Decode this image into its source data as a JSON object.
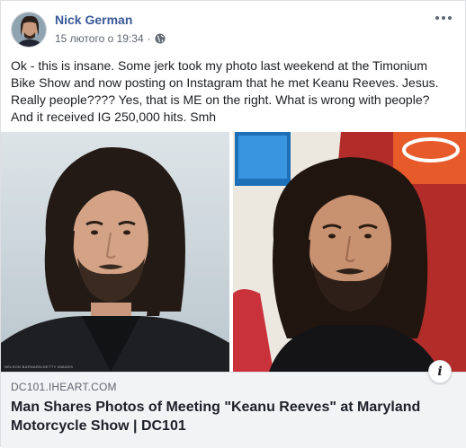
{
  "post": {
    "author": "Nick German",
    "timestamp": "15 лютого о 19:34",
    "separator": "·",
    "privacy_icon": "globe-icon",
    "more_icon": "more-horizontal-icon",
    "text": "Ok - this is insane. Some jerk took my photo last weekend at the Timonium Bike Show and now posting on Instagram that he met Keanu Reeves. Jesus. Really people???? Yes, that is ME on the right. What is wrong with people? And it received IG 250,000 hits. Smh"
  },
  "photos": {
    "left_credit": "NELSON BARNARD/GETTY IMAGES"
  },
  "link_preview": {
    "domain": "DC101.IHEART.COM",
    "title": "Man Shares Photos of Meeting \"Keanu Reeves\" at Maryland Motorcycle Show | DC101",
    "info_label": "i",
    "info_icon": "info-icon"
  },
  "colors": {
    "author_link": "#385898",
    "meta_text": "#606770",
    "preview_bg": "#f2f3f5"
  }
}
